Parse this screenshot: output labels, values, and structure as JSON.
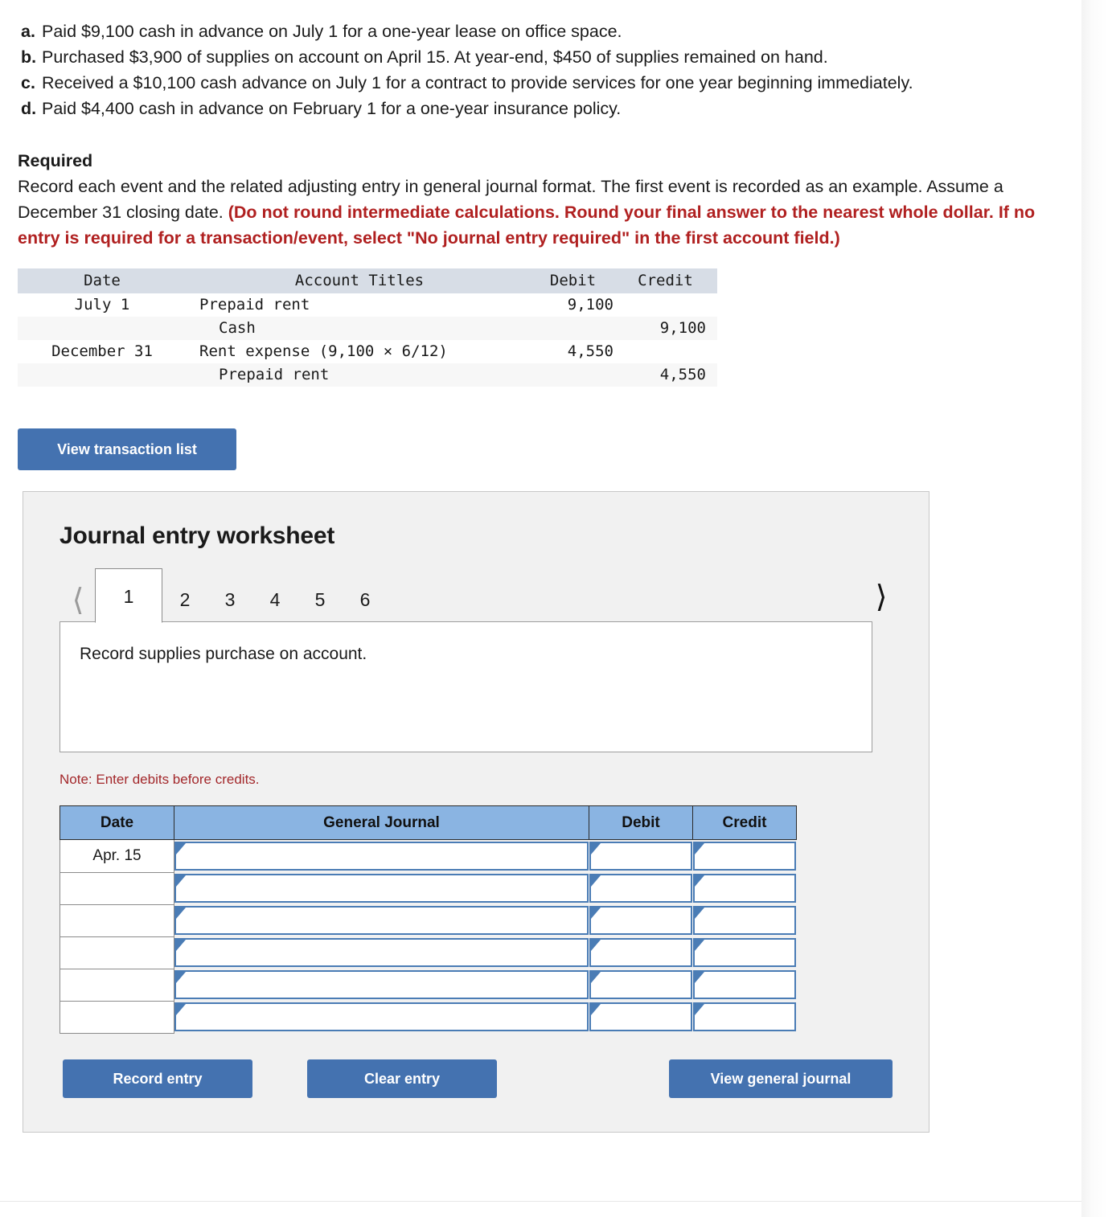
{
  "events": [
    {
      "letter": "a.",
      "text": "Paid $9,100 cash in advance on July 1 for a one-year lease on office space."
    },
    {
      "letter": "b.",
      "text": "Purchased $3,900 of supplies on account on April 15. At year-end, $450 of supplies remained on hand."
    },
    {
      "letter": "c.",
      "text": "Received a $10,100 cash advance on July 1 for a contract to provide services for one year beginning immediately."
    },
    {
      "letter": "d.",
      "text": "Paid $4,400 cash in advance on February 1 for a one-year insurance policy."
    }
  ],
  "required": {
    "title": "Required",
    "body_plain": "Record each event and the related adjusting entry in general journal format. The first event is recorded as an example. Assume a December 31 closing date.",
    "body_red": "(Do not round intermediate calculations. Round your final answer to the nearest whole dollar. If no entry is required for a transaction/event, select \"No journal entry required\" in the first account field.)",
    "red_color": "#b02020"
  },
  "example_table": {
    "headers": [
      "Date",
      "Account Titles",
      "Debit",
      "Credit"
    ],
    "header_bg": "#d7dde6",
    "rows": [
      {
        "date": "July 1",
        "account": "Prepaid rent",
        "indent": false,
        "debit": "9,100",
        "credit": ""
      },
      {
        "date": "",
        "account": "Cash",
        "indent": true,
        "debit": "",
        "credit": "9,100"
      },
      {
        "date": "December 31",
        "account": "Rent expense (9,100 × 6/12)",
        "indent": false,
        "debit": "4,550",
        "credit": ""
      },
      {
        "date": "",
        "account": "Prepaid rent",
        "indent": true,
        "debit": "",
        "credit": "4,550"
      }
    ]
  },
  "view_transaction_list_label": "View transaction list",
  "worksheet": {
    "title": "Journal entry worksheet",
    "prev_icon": "chevron-left",
    "next_icon": "chevron-right",
    "tabs": [
      {
        "label": "1",
        "active": true
      },
      {
        "label": "2",
        "active": false
      },
      {
        "label": "3",
        "active": false
      },
      {
        "label": "4",
        "active": false
      },
      {
        "label": "5",
        "active": false
      },
      {
        "label": "6",
        "active": false
      }
    ],
    "description": "Record supplies purchase on account.",
    "note": "Note: Enter debits before credits.",
    "note_color": "#a3282b",
    "journal": {
      "headers": [
        "Date",
        "General Journal",
        "Debit",
        "Credit"
      ],
      "header_bg": "#8ab4e2",
      "input_border": "#4a7cb5",
      "rows": [
        {
          "date": "Apr. 15",
          "general_journal": "",
          "debit": "",
          "credit": ""
        },
        {
          "date": "",
          "general_journal": "",
          "debit": "",
          "credit": ""
        },
        {
          "date": "",
          "general_journal": "",
          "debit": "",
          "credit": ""
        },
        {
          "date": "",
          "general_journal": "",
          "debit": "",
          "credit": ""
        },
        {
          "date": "",
          "general_journal": "",
          "debit": "",
          "credit": ""
        },
        {
          "date": "",
          "general_journal": "",
          "debit": "",
          "credit": ""
        }
      ]
    },
    "buttons": {
      "record_entry": "Record entry",
      "clear_entry": "Clear entry",
      "view_general_journal": "View general journal",
      "button_color": "#4472b0"
    }
  }
}
